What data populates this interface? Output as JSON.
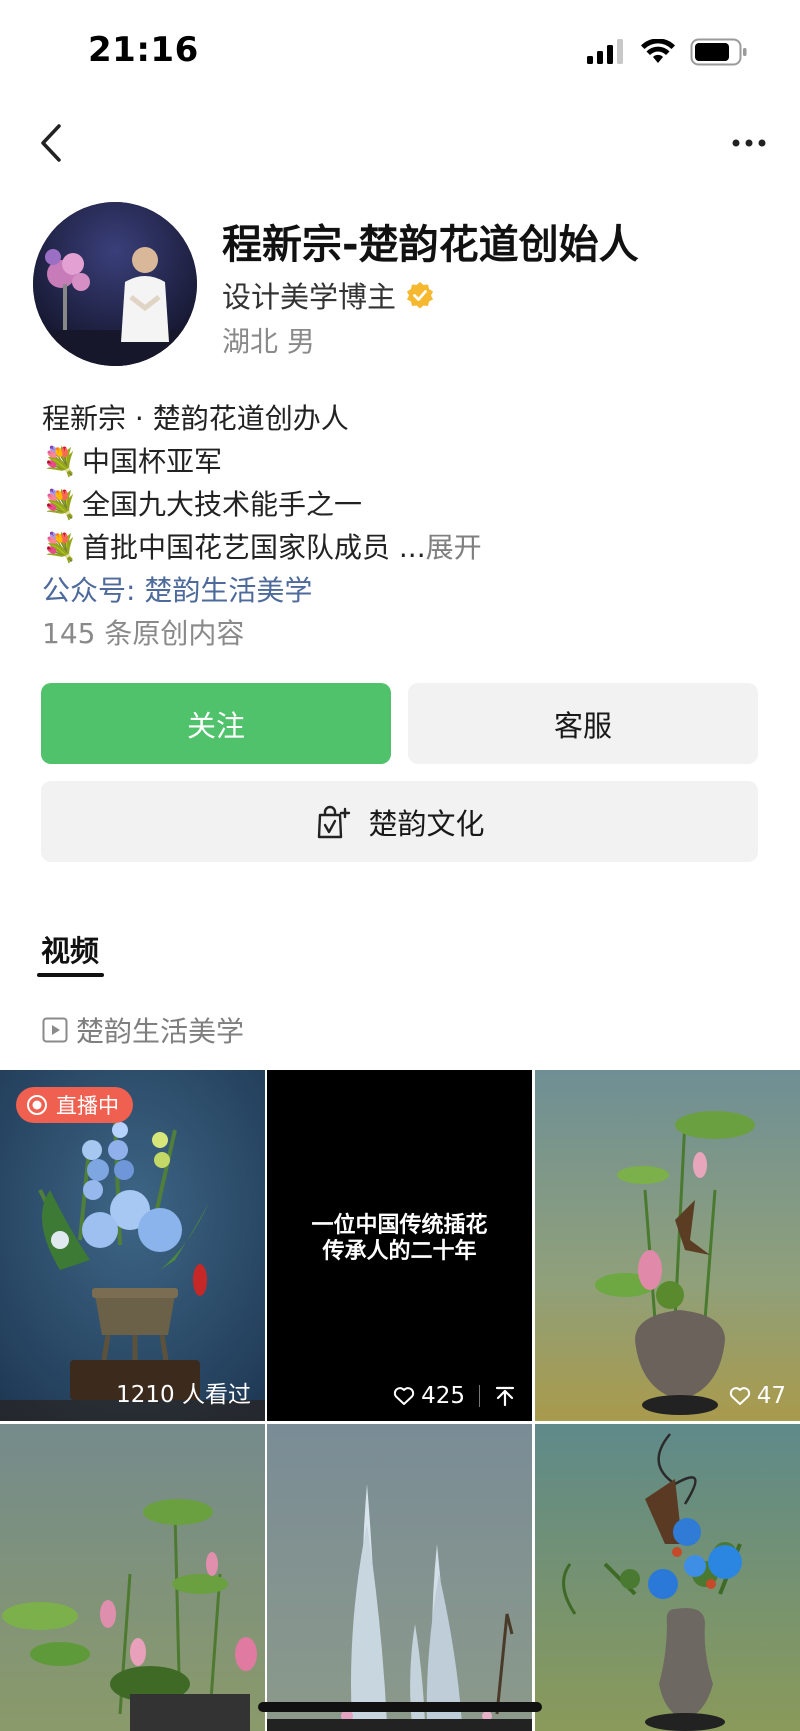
{
  "status_bar": {
    "time": "21:16"
  },
  "profile": {
    "name": "程新宗-楚韵花道创始人",
    "role": "设计美学博主",
    "location": "湖北 男"
  },
  "bio": {
    "line1": "程新宗 · 楚韵花道创办人",
    "items": [
      {
        "emoji": "💐",
        "text": "中国杯亚军"
      },
      {
        "emoji": "💐",
        "text": "全国九大技术能手之一"
      },
      {
        "emoji": "💐",
        "text": "首批中国花艺国家队成员 ..."
      }
    ],
    "expand": "展开",
    "link": "公众号: 楚韵生活美学",
    "count": "145 条原创内容"
  },
  "buttons": {
    "follow": "关注",
    "service": "客服",
    "culture": "楚韵文化"
  },
  "tabs": {
    "video": "视频"
  },
  "series": {
    "label": "楚韵生活美学"
  },
  "videos": [
    {
      "badge": "直播中",
      "caption": "1210 人看过"
    },
    {
      "title_line1": "一位中国传统插花",
      "title_line2": "传承人的二十年",
      "likes": "425"
    },
    {
      "likes": "47"
    },
    {},
    {},
    {}
  ],
  "colors": {
    "accent_green": "#50c26b",
    "link_blue": "#4d6a9b",
    "live_red": "#f06050",
    "verified_gold": "#f5b82e"
  }
}
